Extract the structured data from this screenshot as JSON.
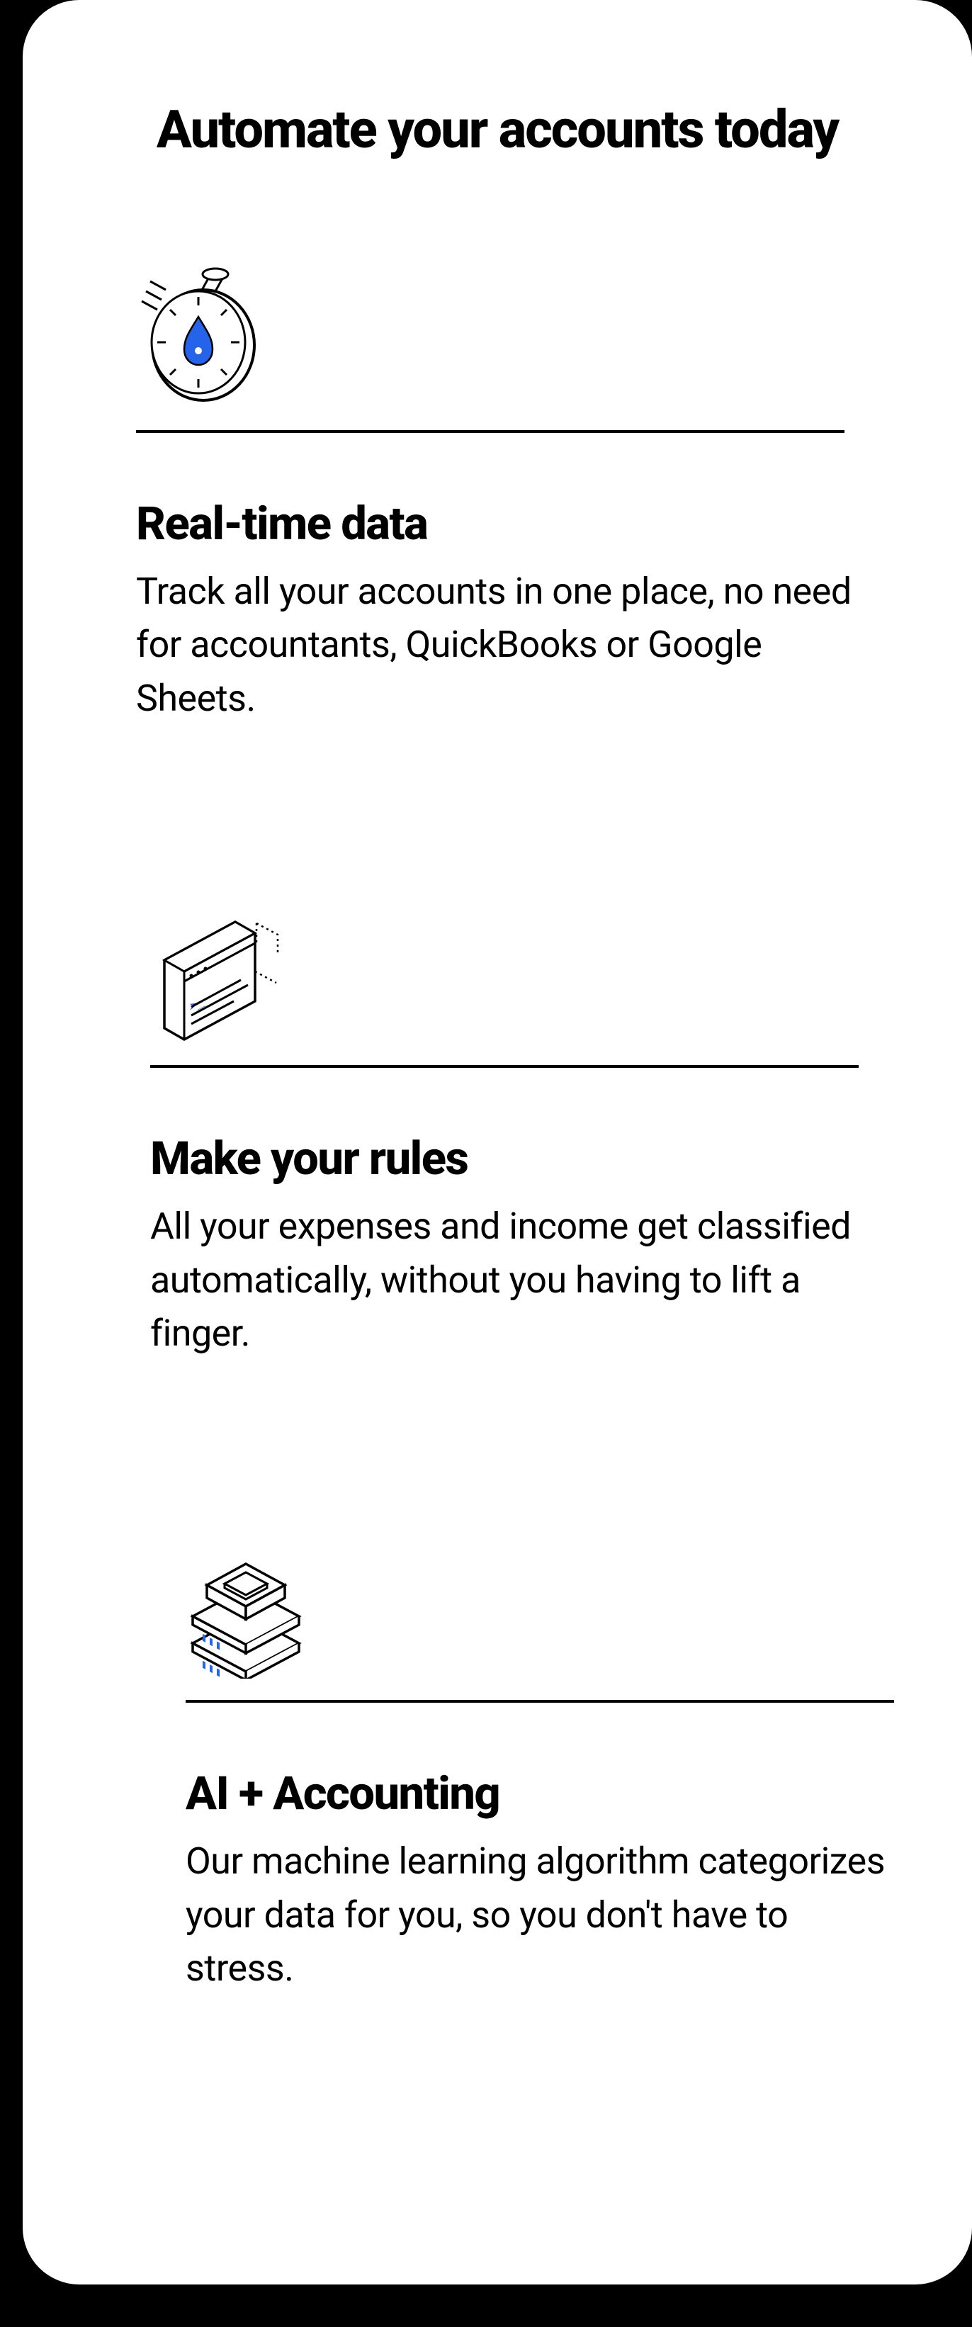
{
  "heading": "Automate your accounts today",
  "features": [
    {
      "icon": "stopwatch-icon",
      "title": "Real-time data",
      "desc": "Track all your accounts in one place, no need for accountants, QuickBooks or Google Sheets."
    },
    {
      "icon": "code-window-icon",
      "title": "Make your rules",
      "desc": "All your expenses and income get classified automatically, without you having to lift a finger."
    },
    {
      "icon": "server-stack-icon",
      "title": "AI + Accounting",
      "desc": "Our machine learning algorithm categorizes your data for you, so you don't have to stress."
    }
  ],
  "colors": {
    "accent": "#2563eb",
    "line": "#000000",
    "bg": "#ffffff"
  }
}
